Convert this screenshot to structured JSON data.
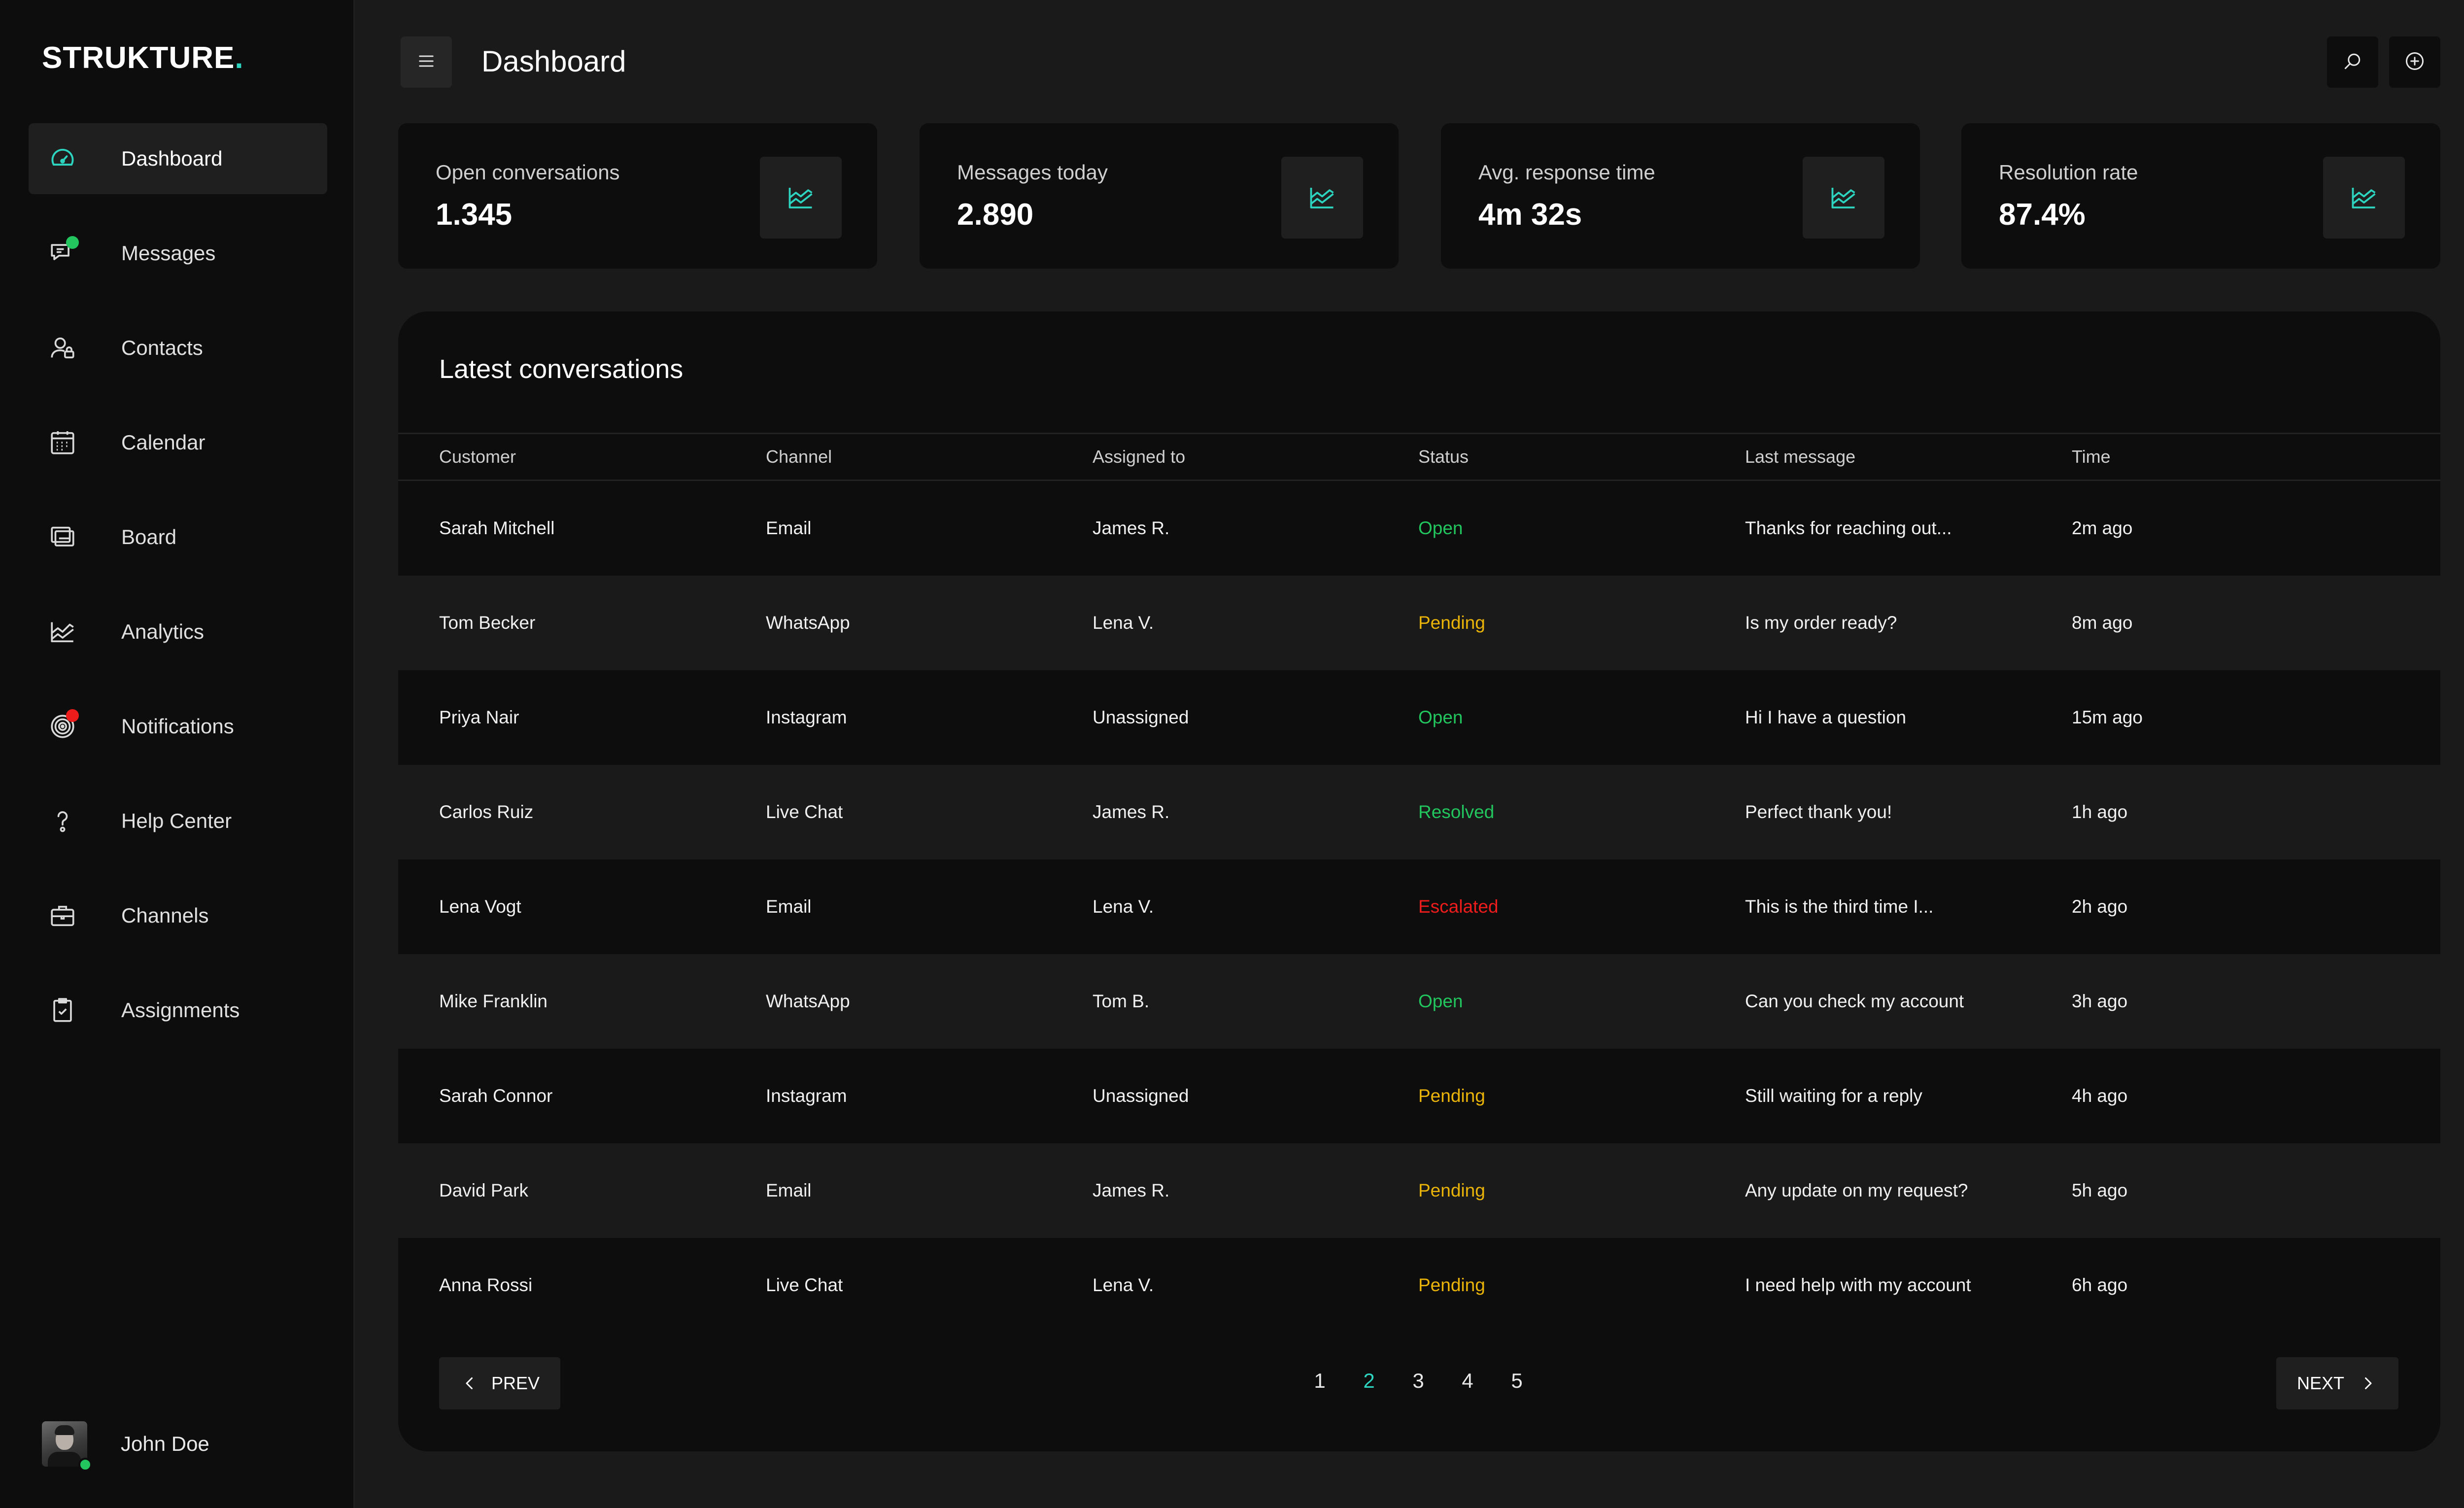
{
  "brand": {
    "name": "STRUKTURE",
    "dot": ".",
    "accent": "#2dd4bf"
  },
  "sidebar": {
    "items": [
      {
        "label": "Dashboard",
        "icon": "dashboard-gauge-icon",
        "active": true
      },
      {
        "label": "Messages",
        "icon": "messages-icon",
        "badge_color": "#22c55e"
      },
      {
        "label": "Contacts",
        "icon": "contacts-icon"
      },
      {
        "label": "Calendar",
        "icon": "calendar-icon"
      },
      {
        "label": "Board",
        "icon": "board-icon"
      },
      {
        "label": "Analytics",
        "icon": "analytics-chart-icon"
      },
      {
        "label": "Notifications",
        "icon": "notifications-target-icon",
        "badge_color": "#ef1c1c"
      },
      {
        "label": "Help Center",
        "icon": "help-icon"
      },
      {
        "label": "Channels",
        "icon": "briefcase-icon"
      },
      {
        "label": "Assignments",
        "icon": "clipboard-check-icon"
      }
    ],
    "user": {
      "name": "John Doe",
      "status_color": "#22c55e"
    }
  },
  "header": {
    "title": "Dashboard",
    "menu_icon": "hamburger-menu-icon",
    "actions": [
      "search-icon",
      "add-circle-icon"
    ]
  },
  "stats": [
    {
      "label": "Open conversations",
      "value": "1.345",
      "icon": "area-chart-icon"
    },
    {
      "label": "Messages today",
      "value": "2.890",
      "icon": "area-chart-icon"
    },
    {
      "label": "Avg. response time",
      "value": "4m 32s",
      "icon": "area-chart-icon"
    },
    {
      "label": "Resolution rate",
      "value": "87.4%",
      "icon": "area-chart-icon"
    }
  ],
  "table": {
    "title": "Latest conversations",
    "columns": [
      "Customer",
      "Channel",
      "Assigned to",
      "Status",
      "Last message",
      "Time"
    ],
    "status_colors": {
      "Open": "#22c55e",
      "Pending": "#eab308",
      "Resolved": "#22c55e",
      "Escalated": "#ef1c1c"
    },
    "rows": [
      {
        "customer": "Sarah Mitchell",
        "channel": "Email",
        "assigned": "James R.",
        "status": "Open",
        "message": "Thanks for reaching out...",
        "time": "2m ago"
      },
      {
        "customer": "Tom Becker",
        "channel": "WhatsApp",
        "assigned": "Lena V.",
        "status": "Pending",
        "message": "Is my order ready?",
        "time": "8m ago"
      },
      {
        "customer": "Priya Nair",
        "channel": "Instagram",
        "assigned": "Unassigned",
        "status": "Open",
        "message": "Hi I have a question",
        "time": "15m ago"
      },
      {
        "customer": "Carlos Ruiz",
        "channel": "Live Chat",
        "assigned": "James R.",
        "status": "Resolved",
        "message": "Perfect thank you!",
        "time": "1h ago"
      },
      {
        "customer": "Lena Vogt",
        "channel": "Email",
        "assigned": "Lena V.",
        "status": "Escalated",
        "message": "This is the third time I...",
        "time": "2h ago"
      },
      {
        "customer": "Mike Franklin",
        "channel": "WhatsApp",
        "assigned": "Tom B.",
        "status": "Open",
        "message": "Can you check my account",
        "time": "3h ago"
      },
      {
        "customer": "Sarah Connor",
        "channel": "Instagram",
        "assigned": "Unassigned",
        "status": "Pending",
        "message": "Still waiting for a reply",
        "time": "4h ago"
      },
      {
        "customer": "David Park",
        "channel": "Email",
        "assigned": "James R.",
        "status": "Pending",
        "message": "Any update on my request?",
        "time": "5h ago"
      },
      {
        "customer": "Anna Rossi",
        "channel": "Live Chat",
        "assigned": "Lena V.",
        "status": "Pending",
        "message": "I need help with my account",
        "time": "6h ago"
      }
    ]
  },
  "pagination": {
    "prev_label": "PREV",
    "next_label": "NEXT",
    "pages": [
      "1",
      "2",
      "3",
      "4",
      "5"
    ],
    "current": "2"
  }
}
